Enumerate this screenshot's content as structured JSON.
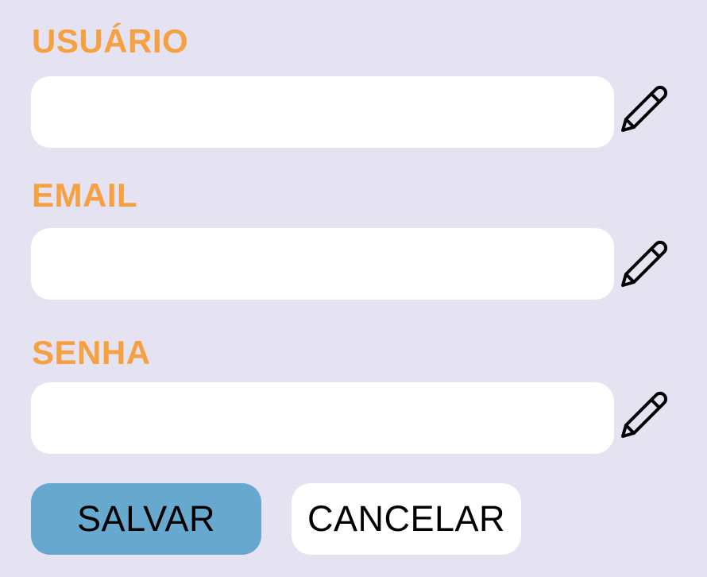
{
  "form": {
    "fields": [
      {
        "label": "USUÁRIO",
        "value": "",
        "placeholder": "",
        "icon": "pencil-icon"
      },
      {
        "label": "EMAIL",
        "value": "",
        "placeholder": "",
        "icon": "pencil-icon"
      },
      {
        "label": "SENHA",
        "value": "",
        "placeholder": "",
        "icon": "pencil-icon"
      }
    ],
    "save_label": "SALVAR",
    "cancel_label": "CANCELAR"
  },
  "colors": {
    "background": "#e5e2f1",
    "label": "#f5a141",
    "input_background": "#ffffff",
    "save_button": "#67a9ce",
    "cancel_button": "#ffffff",
    "button_text": "#000000"
  }
}
